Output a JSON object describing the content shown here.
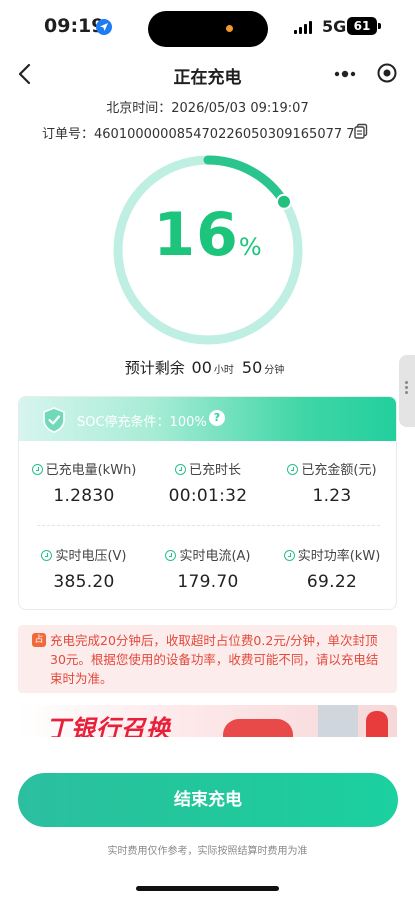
{
  "status_bar": {
    "time": "09:19",
    "network": "5G",
    "battery": "61"
  },
  "nav": {
    "title": "正在充电"
  },
  "session": {
    "beijing_time": "北京时间：2026/05/03 09:19:07",
    "order": "订单号：460100000085470226050309165077 74"
  },
  "progress": {
    "percent_value": 16,
    "number": "16",
    "unit": "%"
  },
  "remaining": {
    "label": "预计剩余",
    "hours": "00",
    "hours_unit": "小时",
    "minutes": "50",
    "minutes_unit": "分钟"
  },
  "soc": {
    "label": "SOC停充条件：100%",
    "help": "?"
  },
  "stats": [
    {
      "label": "已充电量(kWh)",
      "value": "1.2830"
    },
    {
      "label": "已充时长",
      "value": "00:01:32"
    },
    {
      "label": "已充金额(元)",
      "value": "1.23"
    },
    {
      "label": "实时电压(V)",
      "value": "385.20"
    },
    {
      "label": "实时电流(A)",
      "value": "179.70"
    },
    {
      "label": "实时功率(kW)",
      "value": "69.22"
    }
  ],
  "notice": {
    "tag": "占",
    "text": "充电完成20分钟后，收取超时占位费0.2元/分钟，单次封顶30元。根据您使用的设备功率，收费可能不同，请以充电结束时为准。"
  },
  "banner": {
    "text": "丁银行召换"
  },
  "actions": {
    "end_label": "结束充电"
  },
  "footer": {
    "note": "实时费用仅作参考，实际按照结算时费用为准"
  },
  "colors": {
    "accent": "#1cc47c",
    "ring_bg": "#bfeee2",
    "warning": "#e24a3b"
  },
  "icons": {
    "back": "chevron-left-icon",
    "more": "more-dots-icon",
    "close": "target-close-icon",
    "copy": "copy-icon",
    "shield": "shield-check-icon"
  }
}
